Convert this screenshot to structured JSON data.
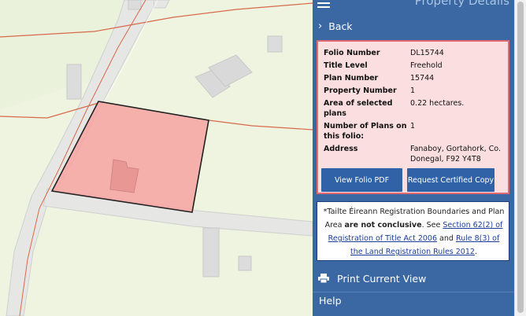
{
  "panel": {
    "title": "Property Details",
    "back_label": "Back",
    "details": [
      {
        "key": "Folio Number",
        "value": "DL15744"
      },
      {
        "key": "Title Level",
        "value": "Freehold"
      },
      {
        "key": "Plan Number",
        "value": "15744"
      },
      {
        "key": "Property Number",
        "value": "1"
      },
      {
        "key": "Area of selected plans",
        "value": "0.22 hectares."
      },
      {
        "key": "Number of Plans on this folio:",
        "value": "1"
      },
      {
        "key": "Address",
        "value": "Fanaboy, Gortahork, Co. Donegal, F92 Y4T8"
      }
    ],
    "view_pdf_label": "View Folio PDF",
    "request_cert_label": "Request Certified Copy",
    "note": {
      "prefix": "*Tailte Éireann Registration Boundaries and Plan Area ",
      "bold": "are not conclusive",
      "mid": ". See ",
      "link1": "Section 62(2) of Registration of Title Act 2006",
      "and": " and ",
      "link2": "Rule 8(3) of the Land Registration Rules 2012",
      "suffix": "."
    },
    "print_label": "Print Current View",
    "help_label": "Help"
  },
  "colors": {
    "panel_bg": "#3b68a3",
    "details_bg": "#fbdfe0",
    "details_border": "#e06a72",
    "button_bg": "#2f62a7",
    "parcel_fill": "#f7a3a1",
    "boundary_line": "#d9694a"
  },
  "icons": {
    "menu": "hamburger-icon",
    "back": "chevron-right-icon",
    "print": "printer-icon"
  }
}
